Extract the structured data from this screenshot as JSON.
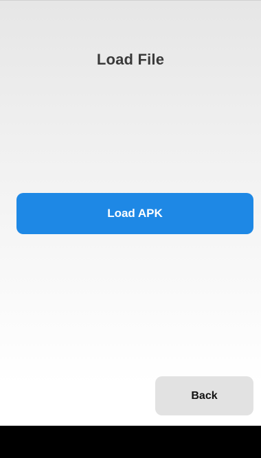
{
  "screen": {
    "title": "Load File"
  },
  "actions": {
    "load_apk_label": "Load APK",
    "back_label": "Back"
  },
  "colors": {
    "primary": "#1e88e5",
    "secondary": "#e2e2e2",
    "nav_bar": "#000000"
  }
}
